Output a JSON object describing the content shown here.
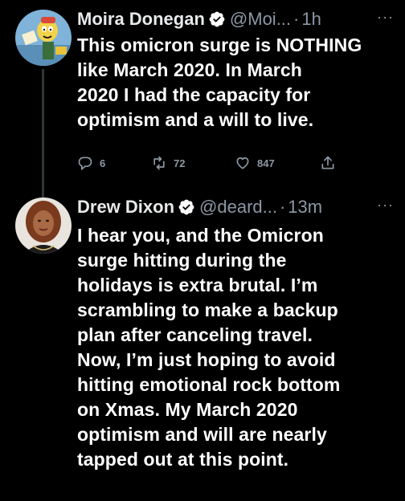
{
  "colors": {
    "background": "#000000",
    "text": "#ffffff",
    "secondary": "#8b98a5",
    "verified": "#ffffff",
    "thread_line": "#333639"
  },
  "tweets": [
    {
      "display_name": "Moira Donegan",
      "handle": "@Moi...",
      "separator": "·",
      "time": "1h",
      "more": "···",
      "text": "This omicron surge is NOTHING\nlike March 2020. In March\n2020 I had the capacity for\noptimism and a will to live.",
      "avatar_icon": "cartoon-avatar-icon",
      "actions": {
        "reply_count": "6",
        "retweet_count": "72",
        "like_count": "847"
      }
    },
    {
      "display_name": "Drew Dixon",
      "handle": "@deard...",
      "separator": "·",
      "time": "13m",
      "more": "···",
      "text": "I hear you, and the Omicron\nsurge hitting during the\nholidays is extra brutal. I’m\nscrambling to make a backup\nplan after canceling travel.\nNow, I’m just hoping to avoid\nhitting emotional rock bottom\non Xmas. My March 2020\noptimism and will are nearly\ntapped out at this point.",
      "avatar_icon": "profile-photo-icon"
    }
  ]
}
